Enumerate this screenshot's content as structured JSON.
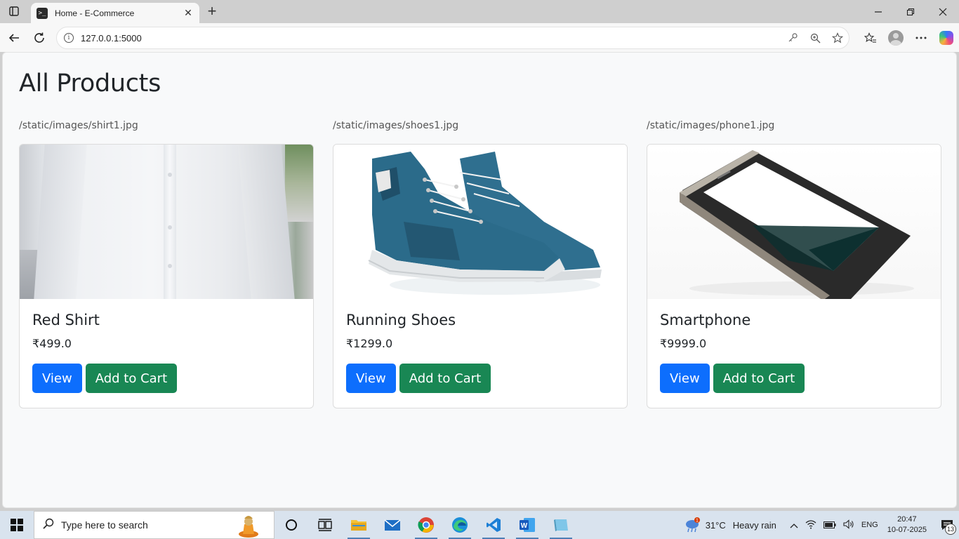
{
  "browser": {
    "tab_title": "Home - E-Commerce",
    "url": "127.0.0.1:5000",
    "new_tab_symbol": "+",
    "close_symbol": "✕"
  },
  "page": {
    "title": "All Products",
    "products": [
      {
        "image_path": "/static/images/shirt1.jpg",
        "name": "Red Shirt",
        "price": "₹499.0",
        "view_label": "View",
        "cart_label": "Add to Cart"
      },
      {
        "image_path": "/static/images/shoes1.jpg",
        "name": "Running Shoes",
        "price": "₹1299.0",
        "view_label": "View",
        "cart_label": "Add to Cart"
      },
      {
        "image_path": "/static/images/phone1.jpg",
        "name": "Smartphone",
        "price": "₹9999.0",
        "view_label": "View",
        "cart_label": "Add to Cart"
      }
    ]
  },
  "taskbar": {
    "search_placeholder": "Type here to search",
    "weather_temp": "31°C",
    "weather_text": "Heavy rain",
    "weather_badge": "1",
    "language": "ENG",
    "time": "20:47",
    "date": "10-07-2025",
    "notification_count": "13"
  },
  "colors": {
    "primary": "#0d6efd",
    "success": "#198754",
    "page_bg": "#f8f9fa"
  }
}
